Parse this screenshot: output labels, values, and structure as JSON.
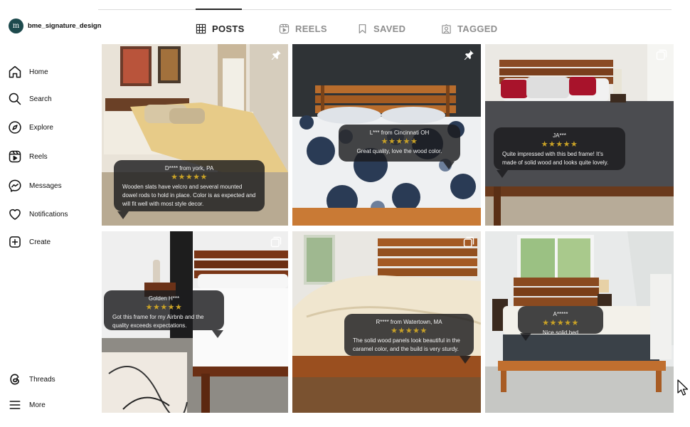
{
  "profile": {
    "avatar_text": "m",
    "username": "bme_signature_design"
  },
  "sidebar": {
    "items": [
      {
        "label": "Home",
        "icon": "home-icon"
      },
      {
        "label": "Search",
        "icon": "search-icon"
      },
      {
        "label": "Explore",
        "icon": "compass-icon"
      },
      {
        "label": "Reels",
        "icon": "reels-icon"
      },
      {
        "label": "Messages",
        "icon": "messenger-icon"
      },
      {
        "label": "Notifications",
        "icon": "heart-icon"
      },
      {
        "label": "Create",
        "icon": "plus-square-icon"
      }
    ],
    "bottom": [
      {
        "label": "Threads",
        "icon": "threads-icon"
      },
      {
        "label": "More",
        "icon": "menu-icon"
      }
    ]
  },
  "tabs": [
    {
      "label": "POSTS",
      "icon": "grid-icon",
      "active": true
    },
    {
      "label": "REELS",
      "icon": "reels-icon",
      "active": false
    },
    {
      "label": "SAVED",
      "icon": "bookmark-icon",
      "active": false
    },
    {
      "label": "TAGGED",
      "icon": "tagged-icon",
      "active": false
    }
  ],
  "posts": [
    {
      "reviewer": "D**** from york, PA",
      "stars": "★★★★★",
      "quote": "Wooden slats have velcro and several mounted dowel rods to hold in place. Color is as expected and will fit well with most style decor.",
      "badge": "pin-icon"
    },
    {
      "reviewer": "L*** from Cincinnati OH",
      "stars": "★★★★★",
      "quote": "Great quality, love the wood color.",
      "badge": "pin-icon"
    },
    {
      "reviewer": "JA***",
      "stars": "★★★★★",
      "quote": "Quite impressed with this bed frame! It's made of solid wood and looks quite lovely.",
      "badge": "multi-post-icon"
    },
    {
      "reviewer": "Golden H***",
      "stars": "★★★★★",
      "quote": "Got this frame for my Airbnb and the quality exceeds expectations.",
      "badge": "multi-post-icon"
    },
    {
      "reviewer": "R**** from Watertown, MA",
      "stars": "★★★★★",
      "quote": "The solid wood panels look beautiful in the caramel color, and the build is very sturdy.",
      "badge": "multi-post-icon"
    },
    {
      "reviewer": "A*****",
      "stars": "★★★★★",
      "quote": "Nice solid bed",
      "badge": ""
    }
  ],
  "colors": {
    "star": "#c9a227",
    "bubble": "#1c1c1e",
    "active_tab": "#262626",
    "inactive_tab": "#8e8e8e"
  }
}
